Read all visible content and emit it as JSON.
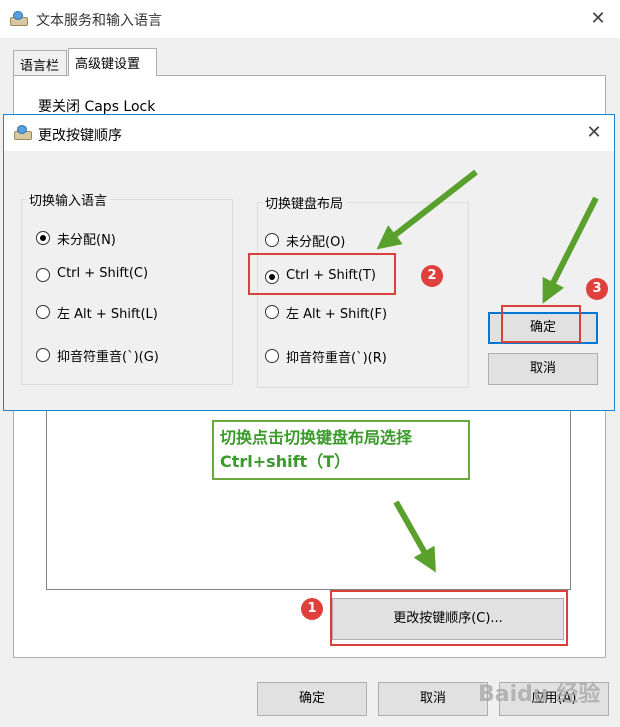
{
  "outer": {
    "title": "文本服务和输入语言",
    "tabs": [
      {
        "label": "语言栏"
      },
      {
        "label": "高级键设置"
      }
    ],
    "caps_lock_label": "要关闭 Caps Lock",
    "change_sequence_button": "更改按键顺序(C)...",
    "ok_button": "确定",
    "cancel_button": "取消",
    "apply_button": "应用(A)"
  },
  "dialog": {
    "title": "更改按键顺序",
    "input_language_group": {
      "title": "切换输入语言",
      "options": [
        "未分配(N)",
        "Ctrl + Shift(C)",
        "左 Alt + Shift(L)",
        "抑音符重音(`)(G)"
      ],
      "selected": 0
    },
    "layout_group": {
      "title": "切换键盘布局",
      "options": [
        "未分配(O)",
        "Ctrl + Shift(T)",
        "左 Alt + Shift(F)",
        "抑音符重音(`)(R)"
      ],
      "selected": 1
    },
    "ok_button": "确定",
    "cancel_button": "取消"
  },
  "annotations": {
    "badges": [
      "1",
      "2",
      "3"
    ],
    "note_line1": "切换点击切换键盘布局选择",
    "note_line2": "Ctrl+shift（T）",
    "arrow_color": "#5aa02c",
    "highlight_color": "#d9413a"
  },
  "watermark": "Baidu 经验"
}
